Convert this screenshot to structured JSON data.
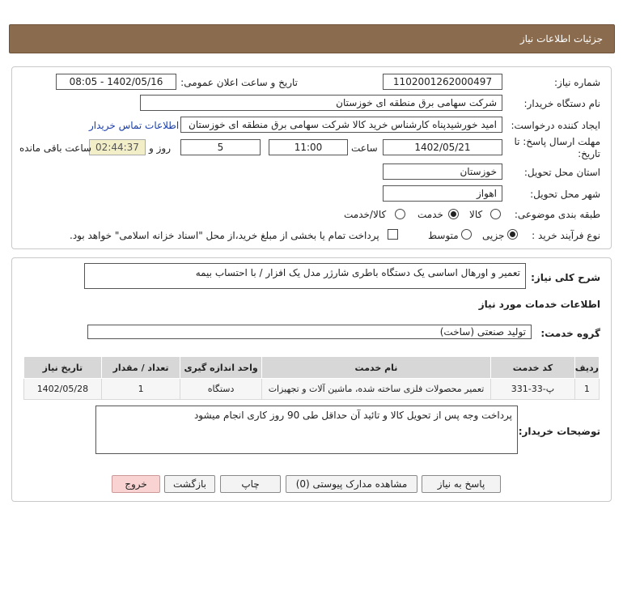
{
  "header": {
    "title": "جزئیات اطلاعات نیاز"
  },
  "info": {
    "need_number": {
      "label": "شماره نیاز:",
      "value": "1102001262000497"
    },
    "announce_datetime": {
      "label": "تاریخ و ساعت اعلان عمومی:",
      "value": "1402/05/16 - 08:05"
    },
    "buyer_org": {
      "label": "نام دستگاه خریدار:",
      "value": "شرکت سهامی برق منطقه ای خوزستان"
    },
    "requester": {
      "label": "ایجاد کننده درخواست:",
      "value": "امید خورشیدپناه کارشناس خرید کالا شرکت سهامی برق منطقه ای خوزستان",
      "contact_link": "اطلاعات تماس خریدار"
    },
    "deadline": {
      "label_line1": "مهلت ارسال پاسخ: تا",
      "label_line2": "تاریخ:",
      "date": "1402/05/21",
      "time_label": "ساعت",
      "time": "11:00",
      "days": "5",
      "days_label": "روز و",
      "remaining": "02:44:37",
      "remaining_label": "ساعت باقی مانده"
    },
    "province": {
      "label": "استان محل تحویل:",
      "value": "خوزستان"
    },
    "city": {
      "label": "شهر محل تحویل:",
      "value": "اهواز"
    },
    "category": {
      "label": "طبقه بندی موضوعی:",
      "options": [
        "کالا",
        "خدمت",
        "کالا/خدمت"
      ],
      "selected": "خدمت"
    },
    "purchase_type": {
      "label": "نوع فرآیند خرید :",
      "options": [
        "جزیی",
        "متوسط"
      ],
      "selected": "جزیی",
      "payment_note": "پرداخت تمام یا بخشی از مبلغ خرید،از محل \"اسناد خزانه اسلامی\" خواهد بود."
    }
  },
  "details": {
    "summary_label": "شرح کلی نیاز:",
    "summary_value": "تعمیر و اورهال اساسی یک دستگاه باطری شارژر مدل یک افزار / با احتساب بیمه",
    "services_heading": "اطلاعات خدمات مورد نیاز",
    "service_group_label": "گروه خدمت:",
    "service_group_value": "تولید صنعتی (ساخت)",
    "table": {
      "headers": [
        "ردیف",
        "کد خدمت",
        "نام خدمت",
        "واحد اندازه گیری",
        "تعداد / مقدار",
        "تاریخ نیاز"
      ],
      "rows": [
        [
          "1",
          "پ-33-331",
          "تعمیر محصولات فلزی ساخته شده، ماشین آلات و تجهیزات",
          "دستگاه",
          "1",
          "1402/05/28"
        ]
      ]
    },
    "buyer_notes_label": "توضیحات خریدار:",
    "buyer_notes_value": "پرداخت وجه پس از تحویل کالا و تائید آن حداقل طی 90 روز کاری انجام میشود"
  },
  "buttons": {
    "reply": "پاسخ به نیاز",
    "attachments": "مشاهده مدارک پیوستی (0)",
    "print": "چاپ",
    "back": "بازگشت",
    "exit": "خروج"
  },
  "colors": {
    "header_bg": "#8b6b4d",
    "timer_bg": "#f1eec8",
    "table_header_bg": "#d7d7d7",
    "exit_button_bg": "#f9d2d2",
    "link": "#1a3ea8"
  }
}
